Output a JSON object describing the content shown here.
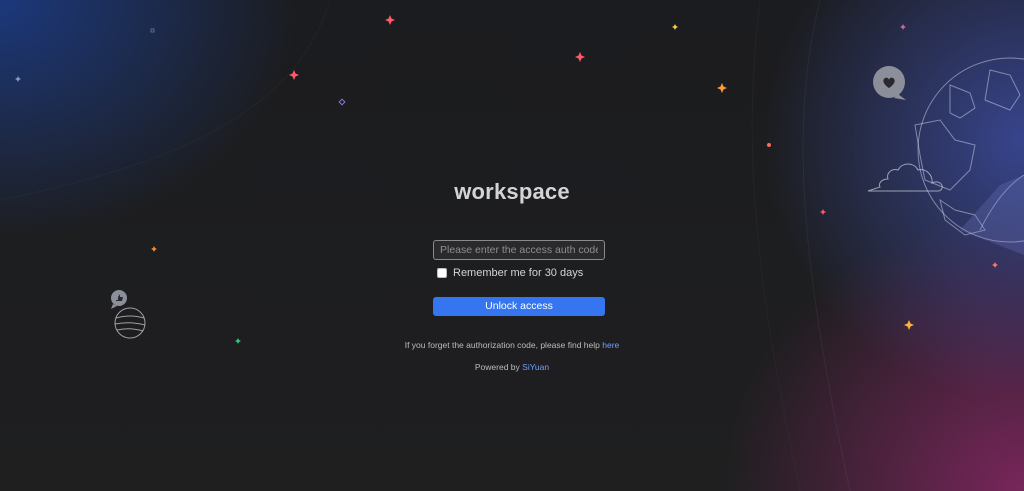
{
  "workspace": {
    "title": "workspace"
  },
  "auth": {
    "placeholder": "Please enter the access auth code",
    "value": "",
    "remember_label": "Remember me for 30 days",
    "remember_checked": false,
    "unlock_label": "Unlock access"
  },
  "help": {
    "text": "If you forget the authorization code, please find help",
    "link_label": "here"
  },
  "footer": {
    "powered_text": "Powered by",
    "powered_link": "SiYuan"
  },
  "icons": {
    "heart_bubble": "heart-chat-icon",
    "like_bubble": "thumbs-up-chat-icon",
    "globe": "globe-icon",
    "planet": "planet-icon",
    "cloud": "cloud-icon"
  },
  "colors": {
    "background": "#1e1e1f",
    "accent": "#3575f0",
    "link": "#6ea0ff",
    "glow_blue": "#1e50c8",
    "glow_magenta": "#96286e"
  }
}
